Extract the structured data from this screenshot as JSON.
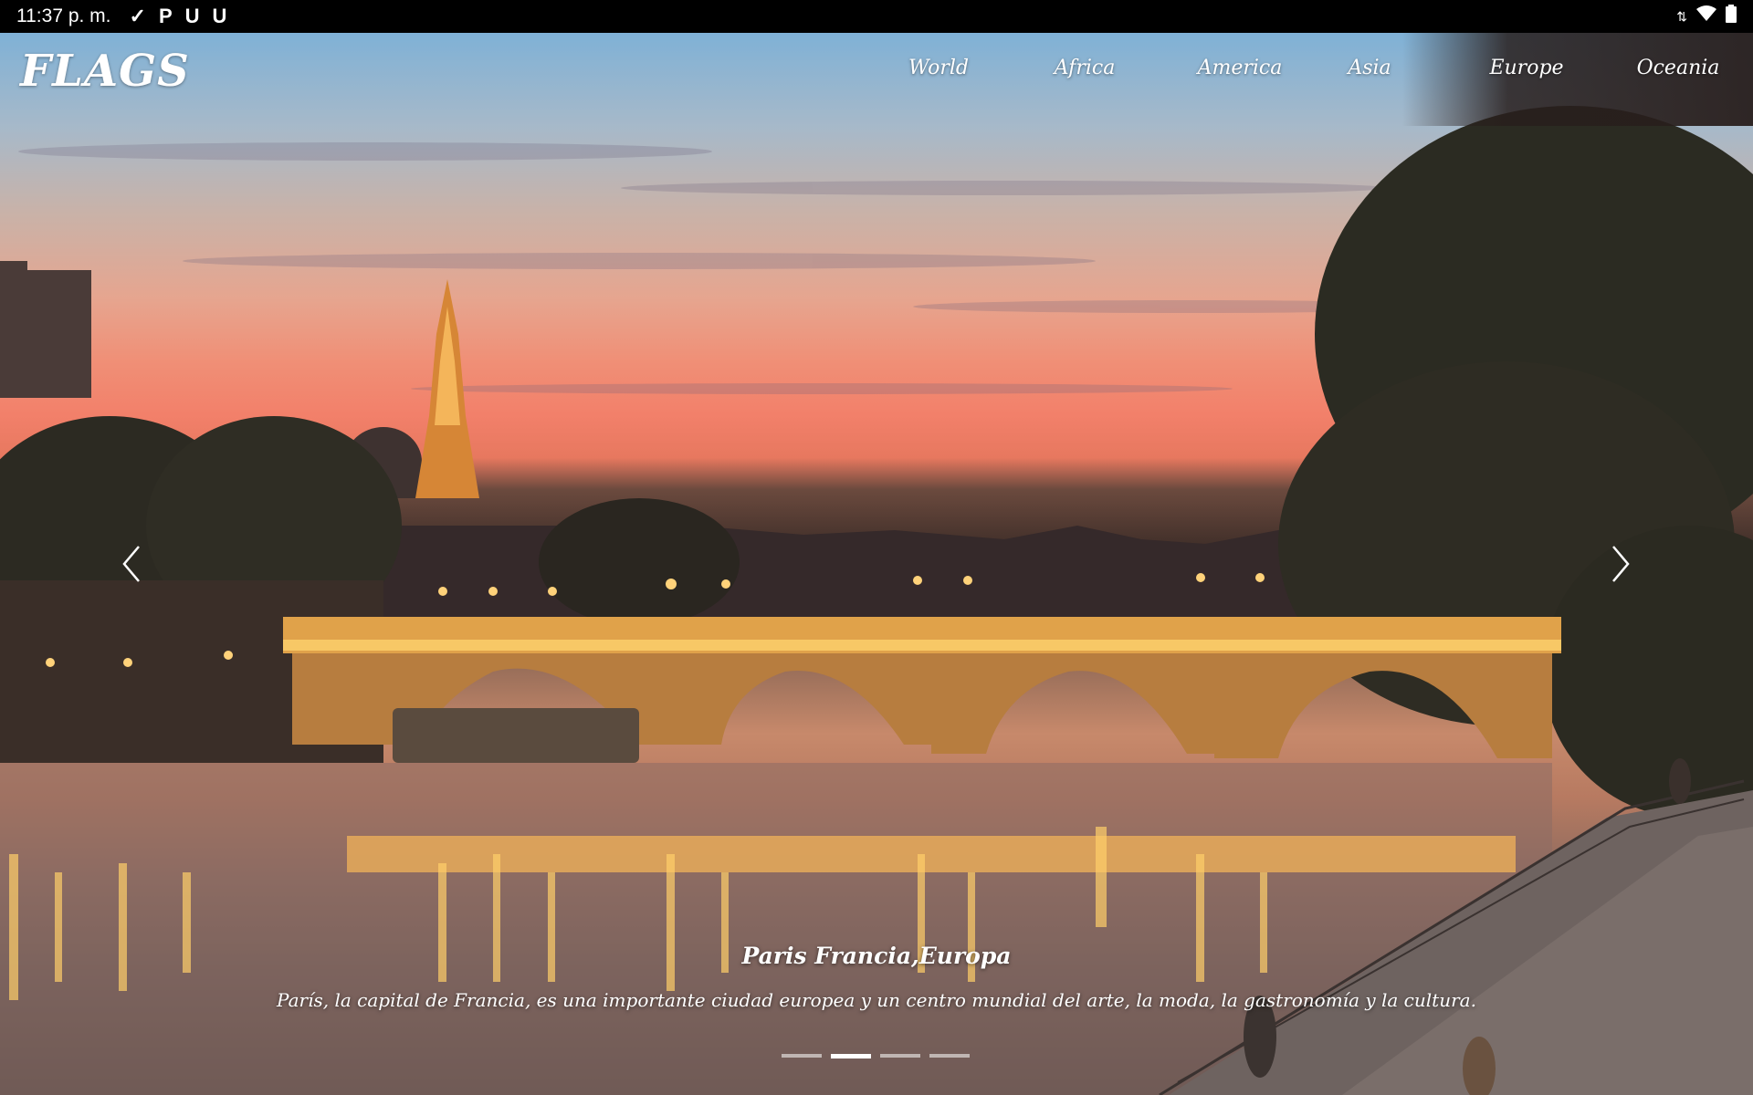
{
  "status_bar": {
    "time": "11:37 p. m.",
    "icons": [
      "check-icon",
      "p-icon",
      "u-icon",
      "u-icon"
    ],
    "right_icons": [
      "data-arrows-icon",
      "wifi-icon",
      "battery-icon"
    ]
  },
  "app": {
    "brand": "FLAGS"
  },
  "nav": {
    "items": [
      {
        "label": "World"
      },
      {
        "label": "Africa"
      },
      {
        "label": "America"
      },
      {
        "label": "Asia"
      },
      {
        "label": "Europe"
      },
      {
        "label": "Oceania"
      }
    ]
  },
  "carousel": {
    "title": "Paris Francia,Europa",
    "description": "París, la capital de Francia, es una importante ciudad europea y un centro mundial del arte, la moda, la gastronomía y la cultura.",
    "slide_count": 4,
    "active_slide": 2,
    "prev_icon": "chevron-left-icon",
    "next_icon": "chevron-right-icon"
  }
}
